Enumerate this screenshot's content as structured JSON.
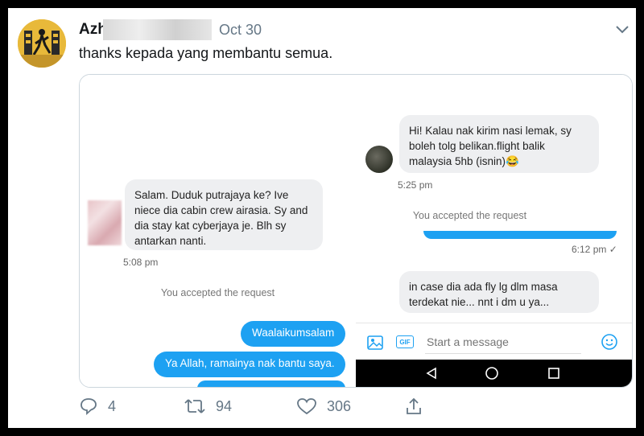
{
  "tweet": {
    "author_visible": "Azh",
    "date": "Oct 30",
    "text": "thanks kepada yang membantu semua."
  },
  "left_chat": {
    "message_in": "Salam. Duduk putrajaya ke? Ive niece dia cabin crew airasia. Sy and dia stay kat cyberjaya je. Blh sy antarkan nanti.",
    "message_in_time": "5:08 pm",
    "system": "You accepted the request",
    "reply_1": "Waalaikumsalam",
    "reply_2": "Ya Allah, ramainya nak bantu saya."
  },
  "right_chat": {
    "message_in_1": "Hi! Kalau nak kirim nasi lemak, sy boleh tolg belikan.flight balik malaysia 5hb (isnin)😂",
    "message_in_1_time": "5:25 pm",
    "system": "You accepted the request",
    "sent_time": "6:12 pm",
    "message_in_2": "in case dia ada fly lg dlm masa terdekat nie... nnt i dm u ya...",
    "input_placeholder": "Start a message",
    "gif_label": "GIF"
  },
  "actions": {
    "replies": "4",
    "retweets": "94",
    "likes": "306"
  },
  "colors": {
    "accent": "#1da1f2",
    "bubble_in": "#eeeff1",
    "muted": "#657786"
  },
  "icons": [
    "reply-icon",
    "retweet-icon",
    "like-icon",
    "share-icon",
    "chevron-down-icon",
    "image-icon",
    "gif-icon",
    "emoji-icon",
    "back-icon",
    "home-icon",
    "recents-icon"
  ]
}
